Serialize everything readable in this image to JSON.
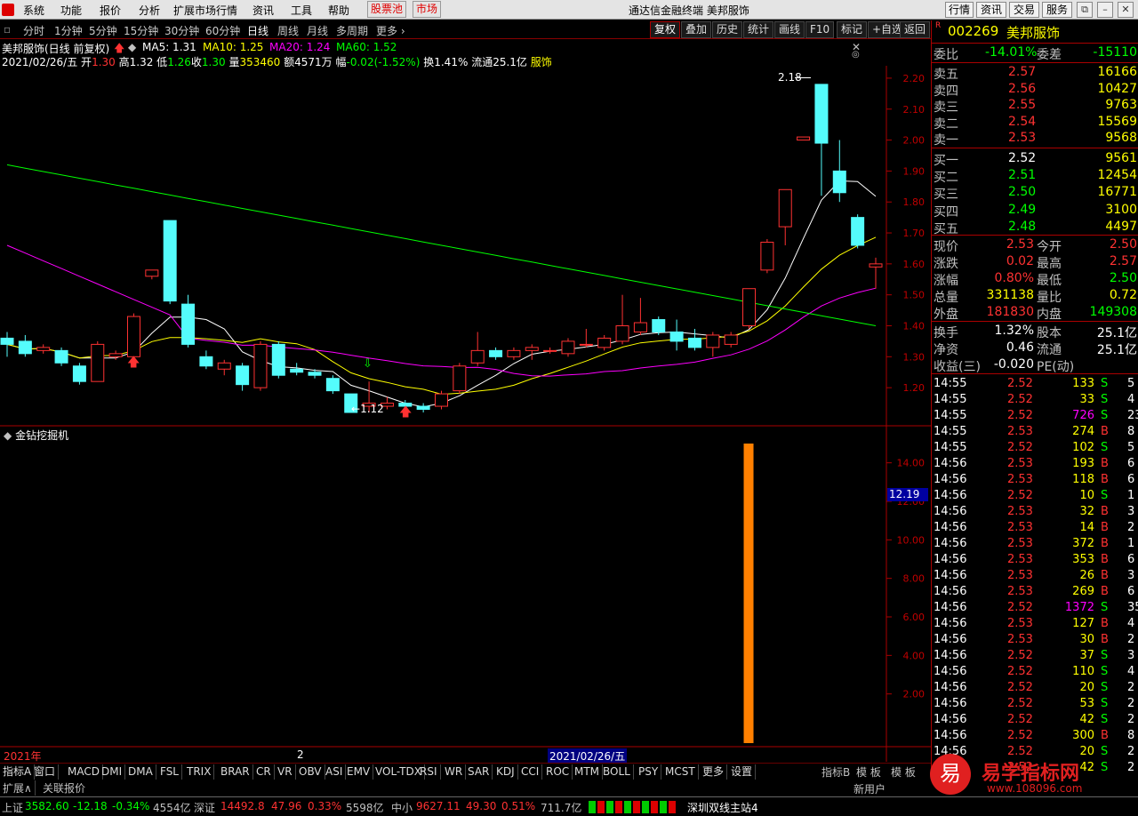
{
  "menu": {
    "items": [
      "系统",
      "功能",
      "报价",
      "分析",
      "扩展市场行情",
      "资讯",
      "工具",
      "帮助"
    ],
    "stock_pool": "股票池",
    "market": "市场",
    "title": "通达信金融终端 美邦服饰",
    "right_buttons": [
      "行情",
      "资讯",
      "交易",
      "服务"
    ]
  },
  "toolbar": {
    "periods": [
      "分时",
      "1分钟",
      "5分钟",
      "15分钟",
      "30分钟",
      "60分钟",
      "日线",
      "周线",
      "月线",
      "多周期",
      "更多"
    ],
    "selected": "日线",
    "actions": [
      "复权",
      "叠加",
      "历史",
      "统计",
      "画线",
      "F10",
      "标记",
      "+自选",
      "返回"
    ]
  },
  "header": {
    "stock": "美邦服饰(日线 前复权)",
    "ma5": "MA5: 1.31",
    "ma10": "MA10: 1.25",
    "ma20": "MA20: 1.24",
    "ma60": "MA60: 1.52",
    "date": "2021/02/26/五",
    "open_label": "开",
    "open": "1.30",
    "high_label": "高",
    "high": "1.32",
    "low_label": "低",
    "low": "1.26",
    "close_label": "收",
    "close": "1.30",
    "vol_label": "量",
    "vol": "353460",
    "amt_label": "额",
    "amt": "4571万",
    "chg_label": "幅",
    "chg": "-0.02(-1.52%)",
    "turn": "换1.41%",
    "float": "流通25.1亿",
    "sector": "服饰"
  },
  "price_axis": [
    "2.20",
    "2.10",
    "2.00",
    "1.90",
    "1.80",
    "1.70",
    "1.60",
    "1.50",
    "1.40",
    "1.30",
    "1.20"
  ],
  "annotations": {
    "high_label": "2.18",
    "low_label": "1.12"
  },
  "indicator": {
    "name": "金钻挖掘机",
    "axis": [
      "14.00",
      "12.00",
      "10.00",
      "8.00",
      "6.00",
      "4.00",
      "2.00"
    ],
    "value_badge": "12.19"
  },
  "date_axis": {
    "year": "2021年",
    "month": "2",
    "cursor": "2021/02/26/五"
  },
  "chart_data": {
    "type": "candlestick",
    "ylim": [
      1.12,
      2.24
    ],
    "candles": [
      {
        "o": 1.36,
        "c": 1.34,
        "h": 1.38,
        "l": 1.3
      },
      {
        "o": 1.35,
        "c": 1.31,
        "h": 1.37,
        "l": 1.3
      },
      {
        "o": 1.32,
        "c": 1.33,
        "h": 1.34,
        "l": 1.31
      },
      {
        "o": 1.32,
        "c": 1.28,
        "h": 1.33,
        "l": 1.27
      },
      {
        "o": 1.27,
        "c": 1.22,
        "h": 1.28,
        "l": 1.21
      },
      {
        "o": 1.22,
        "c": 1.34,
        "h": 1.35,
        "l": 1.22
      },
      {
        "o": 1.3,
        "c": 1.31,
        "h": 1.32,
        "l": 1.29
      },
      {
        "o": 1.3,
        "c": 1.43,
        "h": 1.44,
        "l": 1.29
      },
      {
        "o": 1.56,
        "c": 1.58,
        "h": 1.58,
        "l": 1.55
      },
      {
        "o": 1.74,
        "c": 1.48,
        "h": 1.74,
        "l": 1.47
      },
      {
        "o": 1.47,
        "c": 1.34,
        "h": 1.5,
        "l": 1.33
      },
      {
        "o": 1.3,
        "c": 1.27,
        "h": 1.32,
        "l": 1.26
      },
      {
        "o": 1.26,
        "c": 1.28,
        "h": 1.29,
        "l": 1.24
      },
      {
        "o": 1.27,
        "c": 1.21,
        "h": 1.28,
        "l": 1.19
      },
      {
        "o": 1.2,
        "c": 1.34,
        "h": 1.35,
        "l": 1.19
      },
      {
        "o": 1.34,
        "c": 1.24,
        "h": 1.35,
        "l": 1.23
      },
      {
        "o": 1.26,
        "c": 1.25,
        "h": 1.28,
        "l": 1.24
      },
      {
        "o": 1.25,
        "c": 1.24,
        "h": 1.26,
        "l": 1.23
      },
      {
        "o": 1.23,
        "c": 1.19,
        "h": 1.24,
        "l": 1.18
      },
      {
        "o": 1.18,
        "c": 1.12,
        "h": 1.18,
        "l": 1.12
      },
      {
        "o": 1.14,
        "c": 1.15,
        "h": 1.22,
        "l": 1.12
      },
      {
        "o": 1.14,
        "c": 1.15,
        "h": 1.17,
        "l": 1.13
      },
      {
        "o": 1.15,
        "c": 1.14,
        "h": 1.16,
        "l": 1.13
      },
      {
        "o": 1.14,
        "c": 1.13,
        "h": 1.15,
        "l": 1.12
      },
      {
        "o": 1.14,
        "c": 1.18,
        "h": 1.19,
        "l": 1.13
      },
      {
        "o": 1.19,
        "c": 1.27,
        "h": 1.28,
        "l": 1.18
      },
      {
        "o": 1.28,
        "c": 1.32,
        "h": 1.38,
        "l": 1.27
      },
      {
        "o": 1.32,
        "c": 1.3,
        "h": 1.33,
        "l": 1.29
      },
      {
        "o": 1.3,
        "c": 1.32,
        "h": 1.33,
        "l": 1.29
      },
      {
        "o": 1.32,
        "c": 1.33,
        "h": 1.34,
        "l": 1.29
      },
      {
        "o": 1.32,
        "c": 1.32,
        "h": 1.33,
        "l": 1.31
      },
      {
        "o": 1.31,
        "c": 1.35,
        "h": 1.36,
        "l": 1.3
      },
      {
        "o": 1.34,
        "c": 1.34,
        "h": 1.39,
        "l": 1.33
      },
      {
        "o": 1.33,
        "c": 1.36,
        "h": 1.37,
        "l": 1.32
      },
      {
        "o": 1.35,
        "c": 1.4,
        "h": 1.5,
        "l": 1.34
      },
      {
        "o": 1.38,
        "c": 1.41,
        "h": 1.49,
        "l": 1.37
      },
      {
        "o": 1.42,
        "c": 1.38,
        "h": 1.43,
        "l": 1.37
      },
      {
        "o": 1.38,
        "c": 1.35,
        "h": 1.42,
        "l": 1.32
      },
      {
        "o": 1.36,
        "c": 1.33,
        "h": 1.39,
        "l": 1.32
      },
      {
        "o": 1.33,
        "c": 1.37,
        "h": 1.38,
        "l": 1.3
      },
      {
        "o": 1.34,
        "c": 1.37,
        "h": 1.38,
        "l": 1.33
      },
      {
        "o": 1.4,
        "c": 1.52,
        "h": 1.52,
        "l": 1.39
      },
      {
        "o": 1.58,
        "c": 1.67,
        "h": 1.68,
        "l": 1.57
      },
      {
        "o": 1.72,
        "c": 1.84,
        "h": 1.84,
        "l": 1.66
      },
      {
        "o": 2.0,
        "c": 2.01,
        "h": 2.01,
        "l": 2.0
      },
      {
        "o": 2.18,
        "c": 1.99,
        "h": 2.18,
        "l": 1.82
      },
      {
        "o": 1.9,
        "c": 1.83,
        "h": 2.0,
        "l": 1.8
      },
      {
        "o": 1.75,
        "c": 1.66,
        "h": 1.76,
        "l": 1.65
      },
      {
        "o": 1.59,
        "c": 1.6,
        "h": 1.62,
        "l": 1.52
      }
    ],
    "indicator_values": [
      {
        "index": 41,
        "value": 15.0
      }
    ]
  },
  "quote": {
    "code": "002269",
    "name": "美邦服饰",
    "weibi_label": "委比",
    "weibi": "-14.01%",
    "weicha_label": "委差",
    "weicha": "-15110",
    "asks": [
      {
        "label": "卖五",
        "price": "2.57",
        "vol": "16166"
      },
      {
        "label": "卖四",
        "price": "2.56",
        "vol": "10427"
      },
      {
        "label": "卖三",
        "price": "2.55",
        "vol": "9763"
      },
      {
        "label": "卖二",
        "price": "2.54",
        "vol": "15569"
      },
      {
        "label": "卖一",
        "price": "2.53",
        "vol": "9568"
      }
    ],
    "bids": [
      {
        "label": "买一",
        "price": "2.52",
        "vol": "9561"
      },
      {
        "label": "买二",
        "price": "2.51",
        "vol": "12454"
      },
      {
        "label": "买三",
        "price": "2.50",
        "vol": "16771"
      },
      {
        "label": "买四",
        "price": "2.49",
        "vol": "3100"
      },
      {
        "label": "买五",
        "price": "2.48",
        "vol": "4497"
      }
    ],
    "stats": [
      {
        "l1": "现价",
        "v1": "2.53",
        "l2": "今开",
        "v2": "2.50"
      },
      {
        "l1": "涨跌",
        "v1": "0.02",
        "l2": "最高",
        "v2": "2.57"
      },
      {
        "l1": "涨幅",
        "v1": "0.80%",
        "l2": "最低",
        "v2": "2.50"
      },
      {
        "l1": "总量",
        "v1": "331138",
        "l2": "量比",
        "v2": "0.72"
      },
      {
        "l1": "外盘",
        "v1": "181830",
        "l2": "内盘",
        "v2": "149308"
      }
    ],
    "stats2": [
      {
        "l1": "换手",
        "v1": "1.32%",
        "l2": "股本",
        "v2": "25.1亿"
      },
      {
        "l1": "净资",
        "v1": "0.46",
        "l2": "流通",
        "v2": "25.1亿"
      },
      {
        "l1": "收益(三)",
        "v1": "-0.020",
        "l2": "PE(动)",
        "v2": ""
      }
    ]
  },
  "ticks": [
    {
      "t": "14:55",
      "p": "2.52",
      "v": "133",
      "s": "S",
      "n": "5"
    },
    {
      "t": "14:55",
      "p": "2.52",
      "v": "33",
      "s": "S",
      "n": "4"
    },
    {
      "t": "14:55",
      "p": "2.52",
      "v": "726",
      "s": "S",
      "n": "23"
    },
    {
      "t": "14:55",
      "p": "2.53",
      "v": "274",
      "s": "B",
      "n": "8"
    },
    {
      "t": "14:55",
      "p": "2.52",
      "v": "102",
      "s": "S",
      "n": "5"
    },
    {
      "t": "14:56",
      "p": "2.53",
      "v": "193",
      "s": "B",
      "n": "6"
    },
    {
      "t": "14:56",
      "p": "2.53",
      "v": "118",
      "s": "B",
      "n": "6"
    },
    {
      "t": "14:56",
      "p": "2.52",
      "v": "10",
      "s": "S",
      "n": "1"
    },
    {
      "t": "14:56",
      "p": "2.53",
      "v": "32",
      "s": "B",
      "n": "3"
    },
    {
      "t": "14:56",
      "p": "2.53",
      "v": "14",
      "s": "B",
      "n": "2"
    },
    {
      "t": "14:56",
      "p": "2.53",
      "v": "372",
      "s": "B",
      "n": "1"
    },
    {
      "t": "14:56",
      "p": "2.53",
      "v": "353",
      "s": "B",
      "n": "6"
    },
    {
      "t": "14:56",
      "p": "2.53",
      "v": "26",
      "s": "B",
      "n": "3"
    },
    {
      "t": "14:56",
      "p": "2.53",
      "v": "269",
      "s": "B",
      "n": "6"
    },
    {
      "t": "14:56",
      "p": "2.52",
      "v": "1372",
      "s": "S",
      "n": "35"
    },
    {
      "t": "14:56",
      "p": "2.53",
      "v": "127",
      "s": "B",
      "n": "4"
    },
    {
      "t": "14:56",
      "p": "2.53",
      "v": "30",
      "s": "B",
      "n": "2"
    },
    {
      "t": "14:56",
      "p": "2.52",
      "v": "37",
      "s": "S",
      "n": "3"
    },
    {
      "t": "14:56",
      "p": "2.52",
      "v": "110",
      "s": "S",
      "n": "4"
    },
    {
      "t": "14:56",
      "p": "2.52",
      "v": "20",
      "s": "S",
      "n": "2"
    },
    {
      "t": "14:56",
      "p": "2.52",
      "v": "53",
      "s": "S",
      "n": "2"
    },
    {
      "t": "14:56",
      "p": "2.52",
      "v": "42",
      "s": "S",
      "n": "2"
    },
    {
      "t": "14:56",
      "p": "2.52",
      "v": "300",
      "s": "B",
      "n": "8"
    },
    {
      "t": "14:56",
      "p": "2.52",
      "v": "20",
      "s": "S",
      "n": "2"
    },
    {
      "t": "14:56",
      "p": "2.52",
      "v": "42",
      "s": "S",
      "n": "2"
    }
  ],
  "indicator_tabs": [
    "指标A",
    "窗口",
    "MACD",
    "DMI",
    "DMA",
    "FSL",
    "TRIX",
    "BRAR",
    "CR",
    "VR",
    "OBV",
    "ASI",
    "EMV",
    "VOL-TDX",
    "RSI",
    "WR",
    "SAR",
    "KDJ",
    "CCI",
    "ROC",
    "MTM",
    "BOLL",
    "PSY",
    "MCST",
    "更多",
    "设置"
  ],
  "right_tabs": [
    "指标B",
    "模 板",
    "模 板"
  ],
  "expand": {
    "label": "扩展∧",
    "related": "关联报价",
    "new_user": "新用户"
  },
  "status": {
    "sh_label": "上证",
    "sh": "3582.60",
    "sh_chg": "-12.18",
    "sh_pct": "-0.34%",
    "sh_amt": "4554亿",
    "sz_label": "深证",
    "sz": "14492.8",
    "sz_chg": "47.96",
    "sz_pct": "0.33%",
    "sz_amt": "5598亿",
    "zx_label": "中小",
    "zx": "9627.11",
    "zx_chg": "49.30",
    "zx_pct": "0.51%",
    "zx_amt": "711.7亿",
    "server": "深圳双线主站4"
  },
  "watermark": {
    "text": "易学指标网",
    "url": "www.108096.com",
    "glyph": "易"
  }
}
